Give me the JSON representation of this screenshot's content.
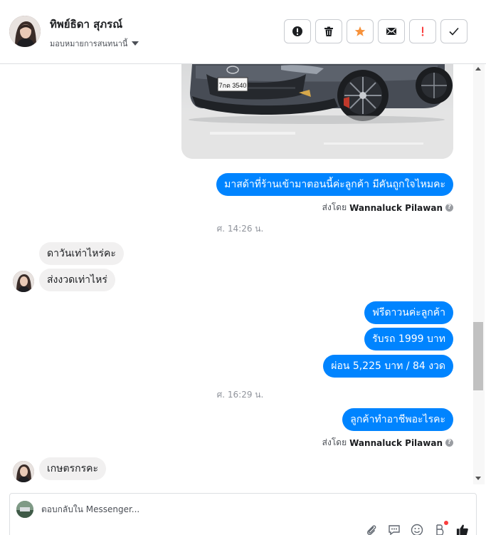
{
  "contact": {
    "name": "ทิพย์ธิดา สุภรณ์",
    "assign_label": "มอบหมายการสนทนานี้"
  },
  "toolbar": {
    "icons": [
      "alert-circle-icon",
      "trash-icon",
      "star-icon",
      "envelope-icon",
      "exclamation-icon",
      "checkmark-icon"
    ],
    "star_color": "#f7923b",
    "alert_color": "#fa3e3e"
  },
  "car_photo": {
    "plate": "7กด 3540"
  },
  "messages": [
    {
      "direction": "outgoing",
      "text": "มาสด้าที่ร้านเข้ามาตอนนี้ค่ะลูกค้า มีคันถูกใจไหมคะ"
    },
    {
      "sent_by_prefix": "ส่งโดย",
      "sent_by_name": "Wannaluck Pilawan"
    },
    {
      "timestamp": "ศ. 14:26 น."
    },
    {
      "direction": "incoming",
      "text": "ดาวันเท่าไหร่คะ"
    },
    {
      "direction": "incoming",
      "text": "ส่งงวดเท่าไหร่"
    },
    {
      "direction": "outgoing",
      "text": "ฟรีดาวนค่ะลูกค้า"
    },
    {
      "direction": "outgoing",
      "text": "รับรถ 1999 บาท"
    },
    {
      "direction": "outgoing",
      "text": "ผ่อน 5,225 บาท / 84 งวด"
    },
    {
      "timestamp": "ศ. 16:29 น."
    },
    {
      "direction": "outgoing",
      "text": "ลูกค้าทำอาชีพอะไรคะ"
    },
    {
      "sent_by_prefix": "ส่งโดย",
      "sent_by_name": "Wannaluck Pilawan"
    },
    {
      "direction": "incoming",
      "text": "เกษตรกรคะ"
    }
  ],
  "composer": {
    "placeholder": "ตอบกลับใน Messenger...",
    "tools": [
      "paperclip-icon",
      "saved-reply-icon",
      "emoji-icon",
      "bot-icon",
      "thumbs-up-icon"
    ]
  },
  "colors": {
    "outgoing_bubble": "#0084ff",
    "incoming_bubble": "#f1f0f0",
    "like_blue": "#1c1e21"
  }
}
